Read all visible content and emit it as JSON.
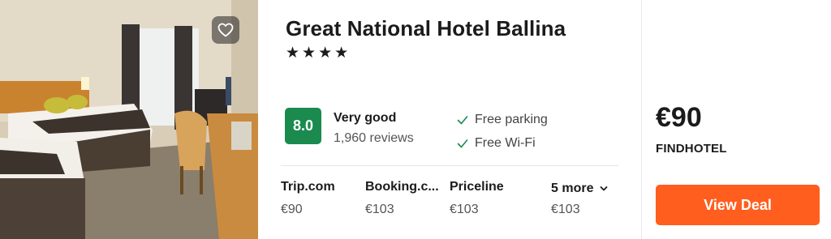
{
  "hotel": {
    "name": "Great National Hotel Ballina",
    "stars": "★★★★"
  },
  "favorite": {
    "icon": "heart-icon"
  },
  "rating": {
    "score": "8.0",
    "label": "Very good",
    "reviews": "1,960 reviews"
  },
  "amenities": [
    {
      "label": "Free parking",
      "icon": "check-icon"
    },
    {
      "label": "Free Wi-Fi",
      "icon": "check-icon"
    }
  ],
  "providers": [
    {
      "name": "Trip.com",
      "price": "€90"
    },
    {
      "name": "Booking.c...",
      "price": "€103"
    },
    {
      "name": "Priceline",
      "price": "€103"
    }
  ],
  "more": {
    "label": "5 more",
    "price": "€103",
    "icon": "chevron-down-icon"
  },
  "best": {
    "price": "€90",
    "provider": "FINDHOTEL",
    "button": "View Deal"
  },
  "colors": {
    "score_bg": "#1a8a4f",
    "deal_button": "#ff5e1f"
  }
}
